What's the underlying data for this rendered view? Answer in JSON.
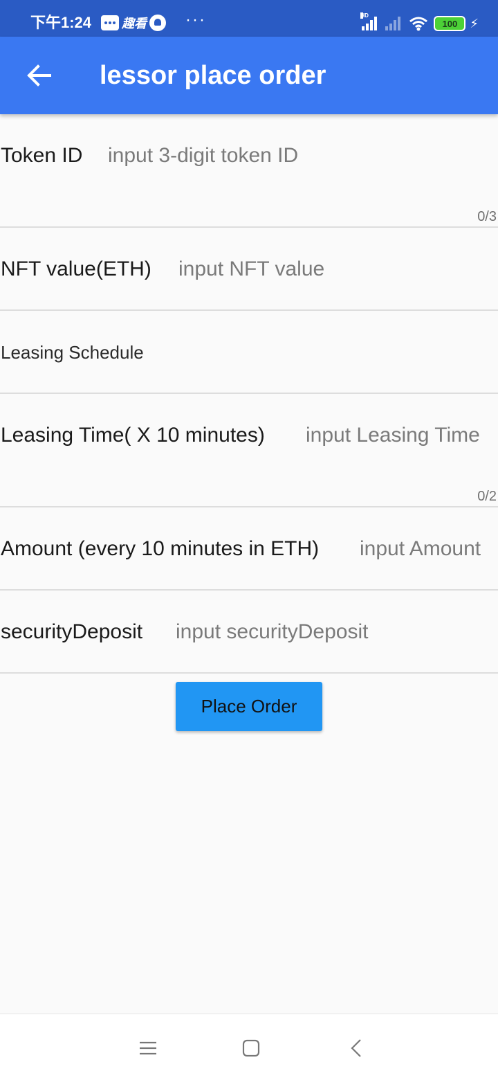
{
  "status_bar": {
    "time": "下午1:24",
    "app_text": "趣看",
    "more": "···",
    "hd": "HD",
    "battery": "100"
  },
  "app_bar": {
    "title": "lessor place order"
  },
  "form": {
    "token_id": {
      "label": "Token ID",
      "placeholder": "input 3-digit token ID",
      "value": "",
      "counter": "0/3"
    },
    "nft_value": {
      "label": "NFT value(ETH)",
      "placeholder": "input NFT value",
      "value": ""
    },
    "leasing_schedule": {
      "label": "Leasing Schedule"
    },
    "leasing_time": {
      "label": "Leasing Time( X 10 minutes)",
      "placeholder": "input Leasing Time",
      "value": "",
      "counter": "0/2"
    },
    "amount": {
      "label": "Amount (every 10 minutes in ETH)",
      "placeholder": "input Amount",
      "value": ""
    },
    "security_deposit": {
      "label": "securityDeposit",
      "placeholder": "input securityDeposit",
      "value": ""
    }
  },
  "actions": {
    "place_order_label": "Place Order"
  },
  "nav_bar": {
    "icons": [
      "menu-icon",
      "home-square-icon",
      "back-chevron-icon"
    ]
  },
  "colors": {
    "status_bar": "#2a5bc4",
    "app_bar": "#3a78f2",
    "button": "#2196f3",
    "background": "#fafafa",
    "divider": "#dddddd"
  }
}
